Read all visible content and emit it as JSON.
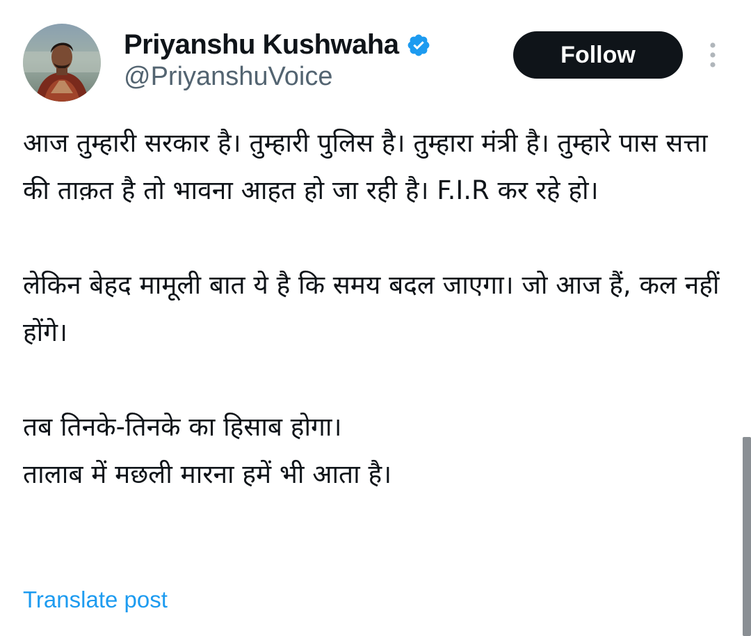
{
  "author": {
    "display_name": "Priyanshu Kushwaha",
    "handle": "@PriyanshuVoice",
    "verified_icon": "verified-badge-icon",
    "avatar_icon": "avatar"
  },
  "actions": {
    "follow_label": "Follow",
    "more_icon": "more-vertical-icon"
  },
  "tweet": {
    "paragraphs": [
      "आज तुम्हारी सरकार है। तुम्हारी पुलिस है। तुम्हारा मंत्री है। तुम्हारे पास सत्ता की ताक़त है तो भावना आहत हो जा रही है। F.I.R कर रहे हो।",
      "लेकिन बेहद मामूली बात ये है कि समय बदल जाएगा। जो आज हैं, कल नहीं होंगे।",
      "तब तिनके-तिनके का हिसाब होगा।",
      "तालाब में मछली मारना हमें भी आता है।"
    ]
  },
  "translate_label": "Translate post",
  "colors": {
    "text": "#0f1419",
    "secondary": "#536471",
    "accent": "#1d9bf0",
    "button_bg": "#0f1419",
    "button_text": "#ffffff"
  }
}
